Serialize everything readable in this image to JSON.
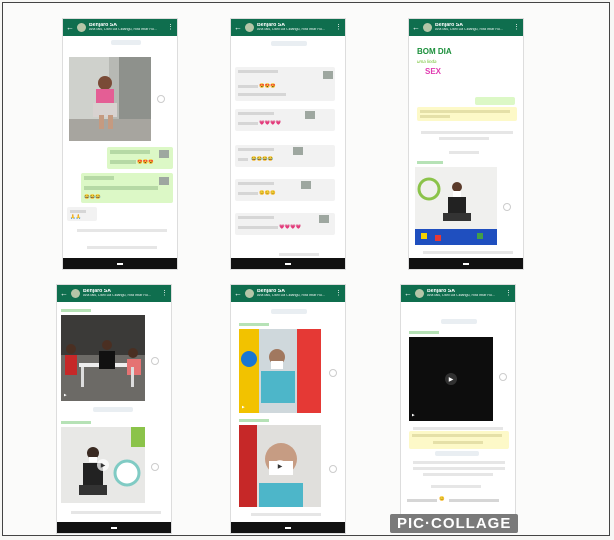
{
  "chat": {
    "contact_name": "Benjaro SA",
    "contact_subtitle": "Ana Ialu, Dani Da Cidangu, Rita Irbar Ru..."
  },
  "phone2": {
    "emoji_row1": "😍😍😍",
    "emoji_row2": "💗💗💗💗",
    "emoji_row3": "😂😂😂😂",
    "emoji_row4": "😊😊😊",
    "emoji_row5": "💗💗💗💗"
  },
  "phone3": {
    "greeting_line1": "BOM DIA",
    "greeting_line2": "uma linda",
    "greeting_line3": "SEX"
  },
  "watermark": "PIC·COLLAGE"
}
